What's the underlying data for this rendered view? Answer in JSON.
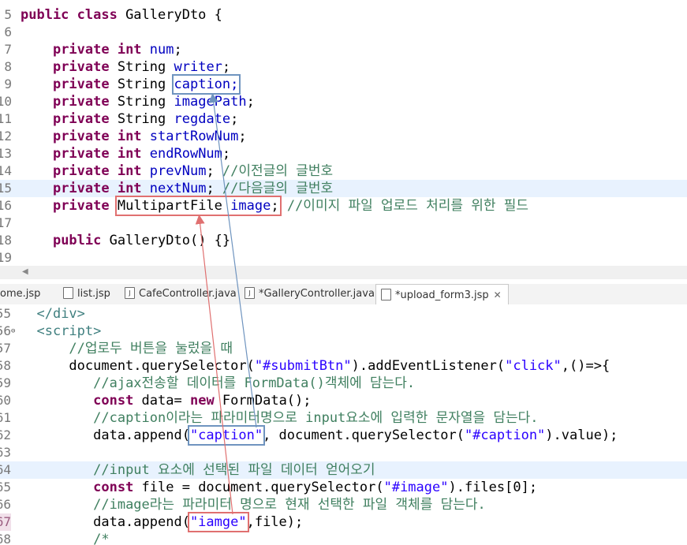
{
  "top_editor": {
    "lines": [
      {
        "n": "5",
        "segments": [
          [
            "kw",
            "public class "
          ],
          [
            "plain",
            "GalleryDto {"
          ]
        ]
      },
      {
        "n": "6",
        "segments": []
      },
      {
        "n": "7",
        "segments": [
          [
            "plain",
            "    "
          ],
          [
            "kw",
            "private int "
          ],
          [
            "fld",
            "num"
          ],
          [
            "plain",
            ";"
          ]
        ]
      },
      {
        "n": "8",
        "segments": [
          [
            "plain",
            "    "
          ],
          [
            "kw",
            "private "
          ],
          [
            "plain",
            "String "
          ],
          [
            "fld",
            "writer"
          ],
          [
            "plain",
            ";"
          ]
        ]
      },
      {
        "n": "9",
        "segments": [
          [
            "plain",
            "    "
          ],
          [
            "kw",
            "private "
          ],
          [
            "plain",
            "String "
          ],
          [
            "fld",
            "caption;",
            "box-blue"
          ]
        ]
      },
      {
        "n": "10",
        "segments": [
          [
            "plain",
            "    "
          ],
          [
            "kw",
            "private "
          ],
          [
            "plain",
            "String "
          ],
          [
            "fld",
            "imagePath"
          ],
          [
            "plain",
            ";"
          ]
        ]
      },
      {
        "n": "11",
        "segments": [
          [
            "plain",
            "    "
          ],
          [
            "kw",
            "private "
          ],
          [
            "plain",
            "String "
          ],
          [
            "fld",
            "regdate"
          ],
          [
            "plain",
            ";"
          ]
        ]
      },
      {
        "n": "12",
        "segments": [
          [
            "plain",
            "    "
          ],
          [
            "kw",
            "private int "
          ],
          [
            "fld",
            "startRowNum"
          ],
          [
            "plain",
            ";"
          ]
        ]
      },
      {
        "n": "13",
        "segments": [
          [
            "plain",
            "    "
          ],
          [
            "kw",
            "private int "
          ],
          [
            "fld",
            "endRowNum"
          ],
          [
            "plain",
            ";"
          ]
        ]
      },
      {
        "n": "14",
        "segments": [
          [
            "plain",
            "    "
          ],
          [
            "kw",
            "private int "
          ],
          [
            "fld",
            "prevNum"
          ],
          [
            "plain",
            "; "
          ],
          [
            "cmt",
            "//이전글의 글번호"
          ]
        ]
      },
      {
        "n": "15",
        "segments": [
          [
            "plain",
            "    "
          ],
          [
            "kw",
            "private int "
          ],
          [
            "fld",
            "nextNum"
          ],
          [
            "plain",
            "; "
          ],
          [
            "cmt",
            "//다음글의 글번호"
          ]
        ],
        "highlight": true
      },
      {
        "n": "16",
        "segments": [
          [
            "plain",
            "    "
          ],
          [
            "kw",
            "private "
          ],
          [
            "plain",
            "MultipartFile ",
            "box-red-start"
          ],
          [
            "fld",
            "image",
            "box-red-mid"
          ],
          [
            "plain",
            ";",
            "box-red-end"
          ],
          [
            "plain",
            " "
          ],
          [
            "cmt",
            "//이미지 파일 업로드 처리를 위한 필드"
          ]
        ]
      },
      {
        "n": "17",
        "segments": []
      },
      {
        "n": "18",
        "segments": [
          [
            "plain",
            "    "
          ],
          [
            "kw",
            "public "
          ],
          [
            "plain",
            "GalleryDto() {}"
          ]
        ]
      },
      {
        "n": "19",
        "segments": []
      }
    ]
  },
  "tabs": [
    {
      "label": "ome.jsp",
      "icon": "jsp-file-icon"
    },
    {
      "label": "list.jsp",
      "icon": "jsp-file-icon"
    },
    {
      "label": "CafeController.java",
      "icon": "java-file-icon"
    },
    {
      "label": "*GalleryController.java",
      "icon": "java-file-icon"
    },
    {
      "label": "*upload_form3.jsp",
      "icon": "jsp-file-icon",
      "active": true,
      "close": "✕"
    }
  ],
  "bottom_editor": {
    "lines": [
      {
        "n": "55",
        "segments": [
          [
            "plain",
            "  "
          ],
          [
            "tag",
            "</div>"
          ]
        ]
      },
      {
        "n": "56",
        "segments": [
          [
            "plain",
            "  "
          ],
          [
            "tag",
            "<script>"
          ]
        ],
        "fold": "⊖"
      },
      {
        "n": "57",
        "segments": [
          [
            "plain",
            "      "
          ],
          [
            "cmt",
            "//업로두 버튼을 눌렀을 때"
          ]
        ]
      },
      {
        "n": "58",
        "segments": [
          [
            "plain",
            "      document.querySelector("
          ],
          [
            "str",
            "\"#submitBtn\""
          ],
          [
            "plain",
            ").addEventListener("
          ],
          [
            "str",
            "\"click\""
          ],
          [
            "plain",
            ",()=>{"
          ]
        ]
      },
      {
        "n": "59",
        "segments": [
          [
            "plain",
            "         "
          ],
          [
            "cmt",
            "//ajax전송할 데이터를 FormData()객체에 담는다."
          ]
        ]
      },
      {
        "n": "60",
        "segments": [
          [
            "plain",
            "         "
          ],
          [
            "kw",
            "const "
          ],
          [
            "plain",
            "data= "
          ],
          [
            "kw",
            "new "
          ],
          [
            "plain",
            "FormData();"
          ]
        ]
      },
      {
        "n": "61",
        "segments": [
          [
            "plain",
            "         "
          ],
          [
            "cmt",
            "//caption이라는 파라미터명으로 input요소에 입력한 문자열을 담는다."
          ]
        ]
      },
      {
        "n": "62",
        "segments": [
          [
            "plain",
            "         data.append("
          ],
          [
            "str",
            "\"caption\"",
            "box-blue"
          ],
          [
            "plain",
            ", document.querySelector("
          ],
          [
            "str",
            "\"#caption\""
          ],
          [
            "plain",
            ").value);"
          ]
        ]
      },
      {
        "n": "63",
        "segments": []
      },
      {
        "n": "64",
        "segments": [
          [
            "plain",
            "         "
          ],
          [
            "cmt",
            "//input 요소에 선택된 파일 데이터 얻어오기"
          ]
        ],
        "highlight": true
      },
      {
        "n": "65",
        "segments": [
          [
            "plain",
            "         "
          ],
          [
            "kw",
            "const "
          ],
          [
            "plain",
            "file = document.querySelector("
          ],
          [
            "str",
            "\"#image\""
          ],
          [
            "plain",
            ").files[0];"
          ]
        ]
      },
      {
        "n": "66",
        "segments": [
          [
            "plain",
            "         "
          ],
          [
            "cmt",
            "//image라는 파라미터 명으로 현재 선택한 파일 객체를 담는다."
          ]
        ]
      },
      {
        "n": "67",
        "segments": [
          [
            "plain",
            "         data.append("
          ],
          [
            "str",
            "\"iamge\"",
            "box-red"
          ],
          [
            "plain",
            ",file);"
          ]
        ],
        "breakpoint": true
      },
      {
        "n": "68",
        "segments": [
          [
            "plain",
            "         "
          ],
          [
            "cmt",
            "/*"
          ]
        ]
      }
    ]
  },
  "colors": {
    "keyword": "#7f0055",
    "field": "#0000c0",
    "comment": "#3f7f5f",
    "string": "#2a00ff",
    "current_line": "#e8f2fe",
    "annotation_blue": "#6f94bf",
    "annotation_red": "#e07070"
  }
}
